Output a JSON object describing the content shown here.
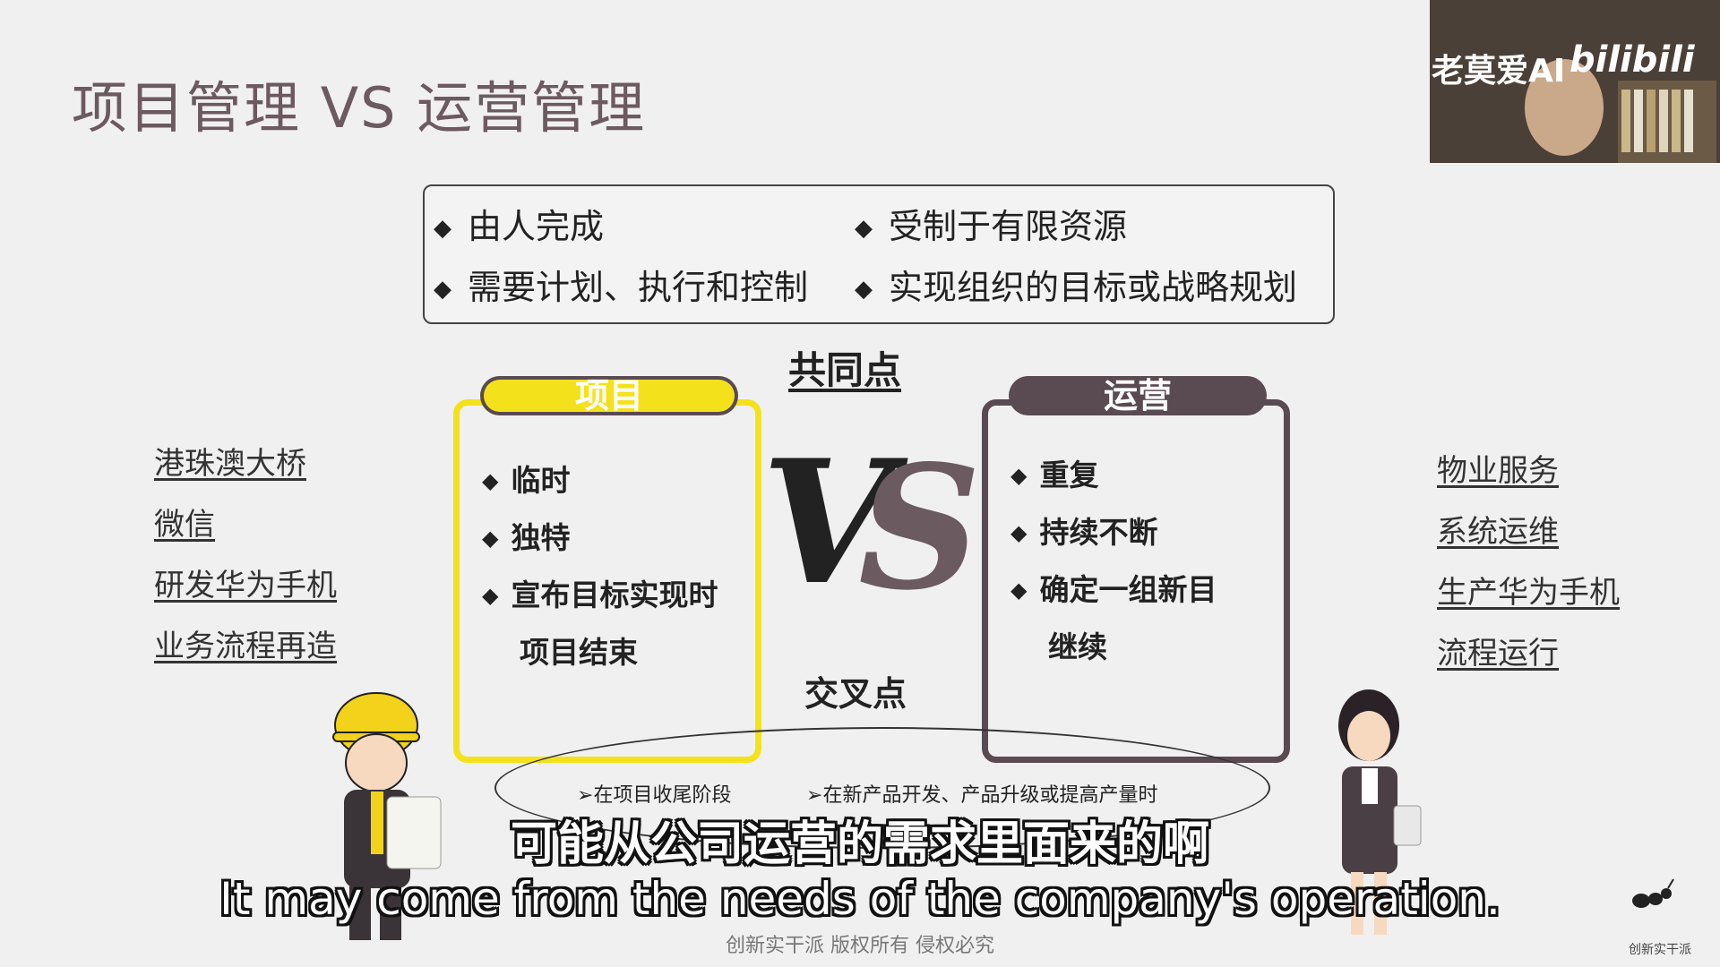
{
  "slide": {
    "title": "项目管理 VS 运营管理",
    "common_points": [
      "由人完成",
      "受制于有限资源",
      "需要计划、执行和控制",
      "实现组织的目标或战略规划"
    ],
    "common_heading": "共同点",
    "project": {
      "tab_label": "项目",
      "items": [
        "临时",
        "独特",
        "宣布目标实现时"
      ],
      "continuation": "项目结束"
    },
    "operations": {
      "tab_label": "运营",
      "items": [
        "重复",
        "持续不断",
        "确定一组新目"
      ],
      "continuation": "继续"
    },
    "vs_text": "VS",
    "intersection_heading": "交叉点",
    "intersection_items": [
      "在项目收尾阶段",
      "在新产品开发、产品升级或提高产量时"
    ],
    "project_examples": [
      "港珠澳大桥",
      "微信",
      "研发华为手机",
      "业务流程再造"
    ],
    "operation_examples": [
      "物业服务",
      "系统运维",
      "生产华为手机",
      "流程运行"
    ],
    "footer": "创新实干派  版权所有 侵权必究",
    "logo_caption": "创新实干派"
  },
  "subtitles": {
    "chinese": "可能从公司运营的需求里面来的啊",
    "english": "It may come from the needs of the company's operation."
  },
  "overlay": {
    "watermark": "老莫爱AI",
    "site_logo": "bilibili"
  },
  "colors": {
    "project": "#f3e21b",
    "operations": "#5a4a52",
    "title": "#6b5a60"
  },
  "icons": {
    "bullet": "diamond-icon",
    "arrow": "chevron-right-icon"
  }
}
